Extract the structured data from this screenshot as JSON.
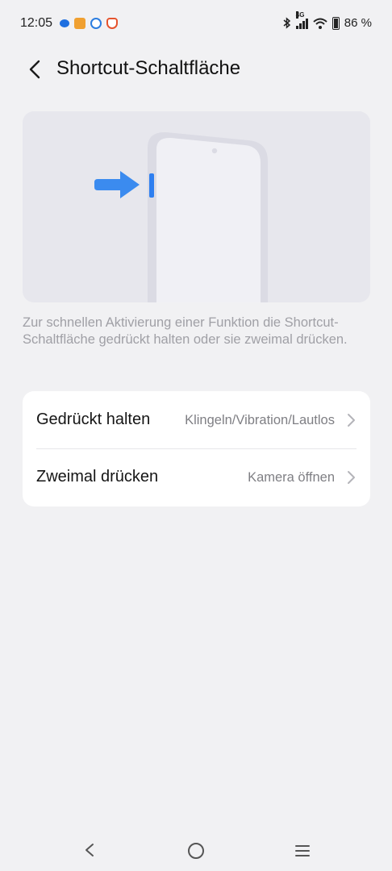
{
  "status_bar": {
    "time": "12:05",
    "network": "4G",
    "battery": "86 %",
    "notification_icons": [
      "message-icon",
      "orange-app-icon",
      "blue-check-icon",
      "brave-icon"
    ]
  },
  "header": {
    "title": "Shortcut-Schaltfläche"
  },
  "description": "Zur schnellen Aktivierung einer Funktion die Shortcut-Schaltfläche gedrückt halten oder sie zweimal drücken.",
  "settings": [
    {
      "label": "Gedrückt halten",
      "value": "Klingeln/Vibration/Lautlos"
    },
    {
      "label": "Zweimal drücken",
      "value": "Kamera öffnen"
    }
  ],
  "colors": {
    "background": "#f1f1f3",
    "card": "#ffffff",
    "illustration_bg": "#e7e7ed",
    "accent_arrow": "#3b8bef",
    "secondary_text": "#a0a0a6"
  }
}
